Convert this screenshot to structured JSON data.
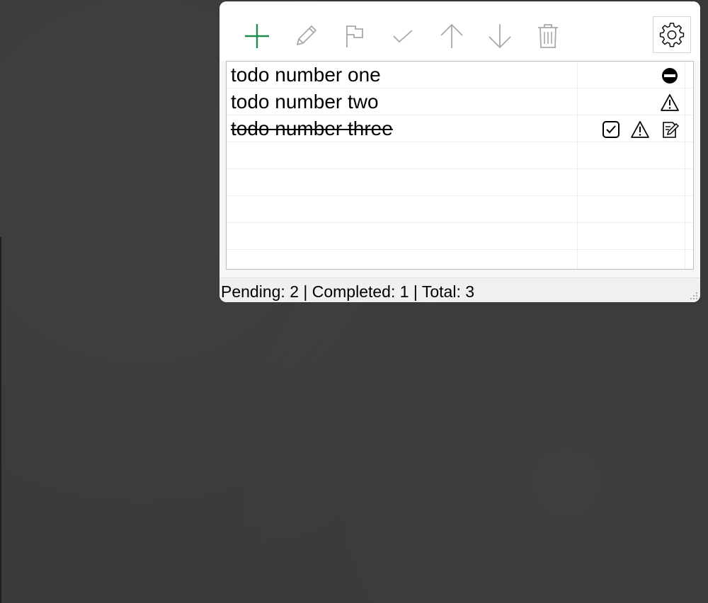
{
  "window": {
    "toolbar": {
      "buttons": [
        {
          "name": "add",
          "icon": "plus-icon",
          "color": "#1f8a4c",
          "enabled": true
        },
        {
          "name": "edit",
          "icon": "pencil-icon",
          "color": "#a8a8a8",
          "enabled": false
        },
        {
          "name": "flag",
          "icon": "flag-icon",
          "color": "#a8a8a8",
          "enabled": false
        },
        {
          "name": "complete",
          "icon": "checkmark-icon",
          "color": "#a8a8a8",
          "enabled": false
        },
        {
          "name": "move-up",
          "icon": "arrow-up-icon",
          "color": "#a8a8a8",
          "enabled": false
        },
        {
          "name": "move-down",
          "icon": "arrow-down-icon",
          "color": "#a8a8a8",
          "enabled": false
        },
        {
          "name": "delete",
          "icon": "trash-icon",
          "color": "#a8a8a8",
          "enabled": false
        }
      ],
      "settings_icon": "gear-icon"
    },
    "todos": [
      {
        "text": "todo number one",
        "completed": false,
        "icons": [
          "stop-icon"
        ]
      },
      {
        "text": "todo number two",
        "completed": false,
        "icons": [
          "warning-icon"
        ]
      },
      {
        "text": "todo number three",
        "completed": true,
        "icons": [
          "checkbox-checked-icon",
          "warning-icon",
          "note-icon"
        ]
      }
    ],
    "empty_rows": 5,
    "status": {
      "text": "Pending: 2 | Completed: 1 | Total: 3"
    }
  }
}
